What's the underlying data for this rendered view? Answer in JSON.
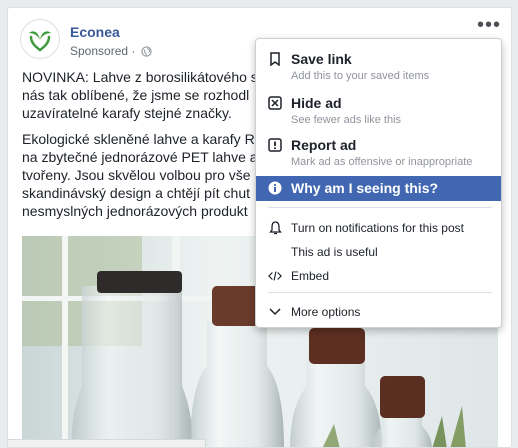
{
  "post": {
    "page_name": "Econea",
    "sponsored_label": "Sponsored · ",
    "text_lines": [
      "NOVINKA: Lahve z borosilikátového s",
      "nás tak oblíbené, že jsme se rozhodl",
      "uzavíratelné karafy stejné značky."
    ],
    "text_lines_2": [
      "Ekologické skleněné lahve a karafy R",
      "na zbytečné jednorázové PET lahve a",
      "tvořeny. Jsou skvělou volbou pro vše",
      "skandinávský design a chtějí pít chut",
      "nesmyslných jednorázových produkt"
    ]
  },
  "menu": {
    "save_link": {
      "title": "Save link",
      "subtitle": "Add this to your saved items"
    },
    "hide_ad": {
      "title": "Hide ad",
      "subtitle": "See fewer ads like this"
    },
    "report_ad": {
      "title": "Report ad",
      "subtitle": "Mark ad as offensive or inappropriate"
    },
    "why_seeing": {
      "title": "Why am I seeing this?"
    },
    "notifications": "Turn on notifications for this post",
    "ad_useful": "This ad is useful",
    "embed": "Embed",
    "more_options": "More options"
  },
  "colors": {
    "brand_link": "#385898",
    "highlight": "#4267b2",
    "logo_green": "#3d9a3a"
  },
  "icons": [
    "avatar-logo-icon",
    "globe-icon",
    "more-options-icon",
    "bookmark-icon",
    "hide-icon",
    "report-icon",
    "info-icon",
    "bell-icon",
    "embed-icon",
    "chevron-down-icon"
  ]
}
